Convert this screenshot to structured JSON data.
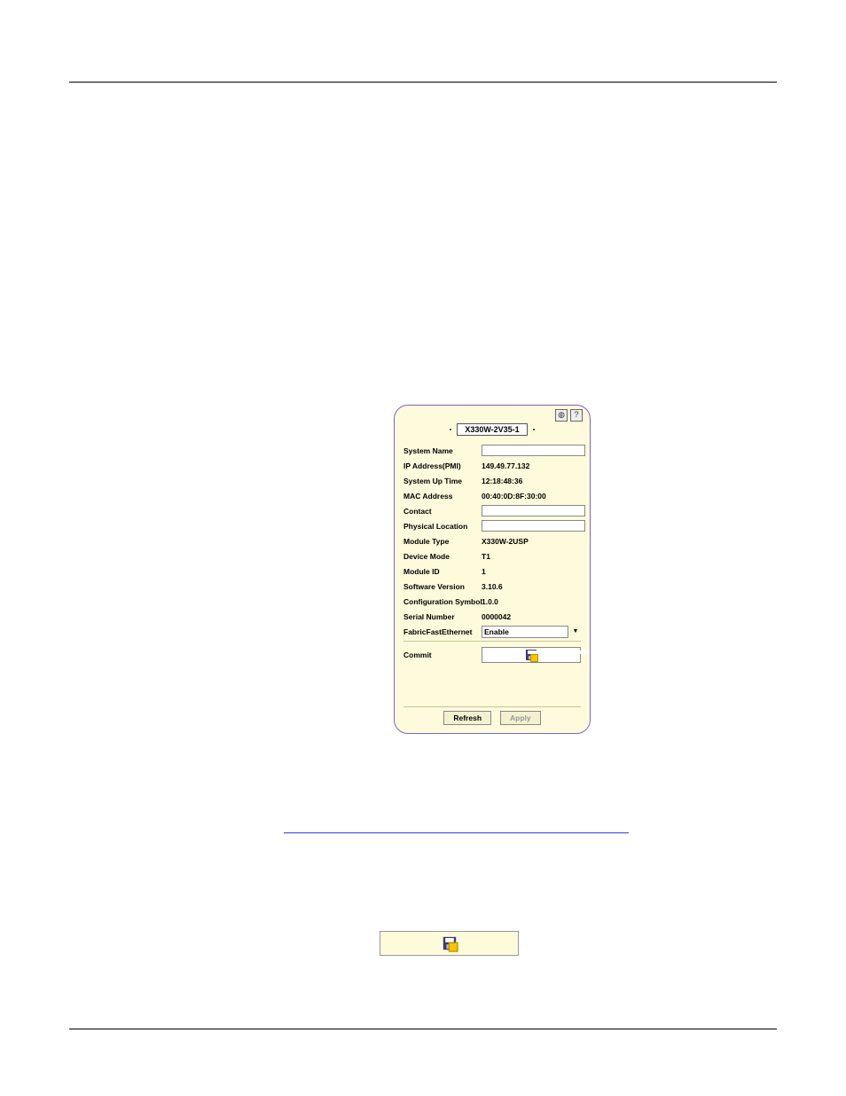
{
  "panel": {
    "title": "X330W-2V35-1",
    "help_icon": "?",
    "fields": {
      "system_name": {
        "label": "System Name",
        "value": ""
      },
      "ip_address": {
        "label": "IP Address(PMI)",
        "value": "149.49.77.132"
      },
      "uptime": {
        "label": "System Up Time",
        "value": "12:18:48:36"
      },
      "mac": {
        "label": "MAC Address",
        "value": "00:40:0D:8F:30:00"
      },
      "contact": {
        "label": "Contact",
        "value": ""
      },
      "location": {
        "label": "Physical Location",
        "value": ""
      },
      "module_type": {
        "label": "Module Type",
        "value": "X330W-2USP"
      },
      "device_mode": {
        "label": "Device Mode",
        "value": "T1"
      },
      "module_id": {
        "label": "Module ID",
        "value": "1"
      },
      "sw_version": {
        "label": "Software Version",
        "value": "3.10.6"
      },
      "config_symbol": {
        "label": "Configuration Symbol",
        "value": "1.0.0"
      },
      "serial": {
        "label": "Serial Number",
        "value": "0000042"
      },
      "ffe": {
        "label": "FabricFastEthernet",
        "value": "Enable"
      }
    },
    "commit": {
      "label": "Commit"
    },
    "buttons": {
      "refresh": "Refresh",
      "apply": "Apply"
    }
  }
}
